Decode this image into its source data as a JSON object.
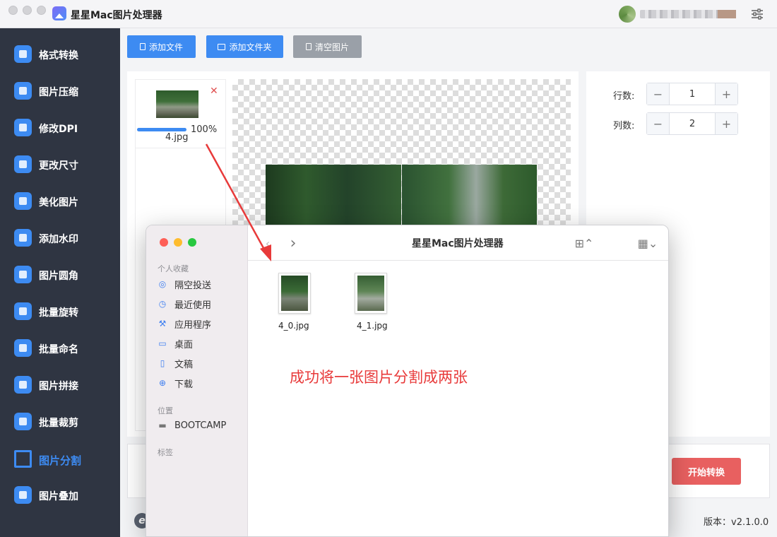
{
  "app": {
    "title": "星星Mac图片处理器",
    "version": "版本：v2.1.0.0",
    "footer_logo": "e"
  },
  "sidebar": {
    "items": [
      {
        "label": "格式转换",
        "icon": "format-convert-icon"
      },
      {
        "label": "图片压缩",
        "icon": "compress-icon"
      },
      {
        "label": "修改DPI",
        "icon": "dpi-icon"
      },
      {
        "label": "更改尺寸",
        "icon": "resize-icon"
      },
      {
        "label": "美化图片",
        "icon": "beautify-icon"
      },
      {
        "label": "添加水印",
        "icon": "watermark-icon"
      },
      {
        "label": "图片圆角",
        "icon": "rounded-corner-icon"
      },
      {
        "label": "批量旋转",
        "icon": "rotate-icon"
      },
      {
        "label": "批量命名",
        "icon": "rename-icon"
      },
      {
        "label": "图片拼接",
        "icon": "stitch-icon"
      },
      {
        "label": "批量裁剪",
        "icon": "crop-icon"
      },
      {
        "label": "图片分割",
        "icon": "split-icon",
        "active": true
      },
      {
        "label": "图片叠加",
        "icon": "layers-icon"
      }
    ]
  },
  "toolbar": {
    "add_file": "添加文件",
    "add_folder": "添加文件夹",
    "clear": "清空图片"
  },
  "file": {
    "name": "4.jpg",
    "progress": "100%",
    "progress_value": 1.0
  },
  "settings": {
    "rows_label": "行数:",
    "rows_value": "1",
    "cols_label": "列数:",
    "cols_value": "2",
    "minus": "−",
    "plus": "+"
  },
  "start_button": "开始转换",
  "finder": {
    "title": "星星Mac图片处理器",
    "sections": {
      "favorites": "个人收藏",
      "locations": "位置",
      "tags": "标签"
    },
    "favorites": [
      {
        "label": "隔空投送",
        "icon": "airdrop-icon"
      },
      {
        "label": "最近使用",
        "icon": "recents-icon"
      },
      {
        "label": "应用程序",
        "icon": "applications-icon"
      },
      {
        "label": "桌面",
        "icon": "desktop-icon"
      },
      {
        "label": "文稿",
        "icon": "documents-icon"
      },
      {
        "label": "下载",
        "icon": "downloads-icon"
      }
    ],
    "locations": [
      {
        "label": "BOOTCAMP",
        "icon": "drive-icon"
      }
    ],
    "files": [
      {
        "name": "4_0.jpg"
      },
      {
        "name": "4_1.jpg"
      }
    ]
  },
  "annotation": "成功将一张图片分割成两张",
  "colors": {
    "accent": "#3d8bf2",
    "sidebar_bg": "#2f3542",
    "start": "#e86060",
    "annotation": "#e83a3a"
  }
}
